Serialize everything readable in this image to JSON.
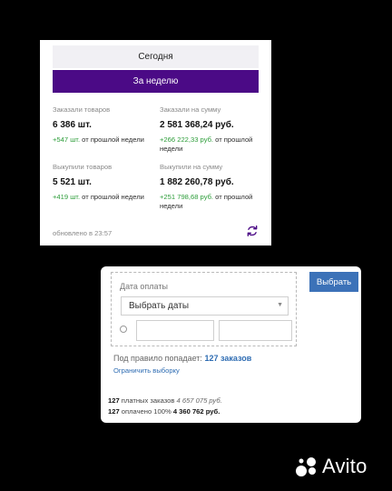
{
  "period": {
    "today": "Сегодня",
    "week": "За неделю"
  },
  "stats": [
    {
      "label": "Заказали товаров",
      "value": "6 386 шт.",
      "delta": "+547 шт.",
      "suffix": " от прошлой недели"
    },
    {
      "label": "Заказали на сумму",
      "value": "2 581 368,24 руб.",
      "delta": "+266 222,33 руб.",
      "suffix": " от прошлой недели"
    },
    {
      "label": "Выкупили товаров",
      "value": "5 521 шт.",
      "delta": "+419 шт.",
      "suffix": " от прошлой недели"
    },
    {
      "label": "Выкупили на сумму",
      "value": "1 882 260,78 руб.",
      "delta": "+251 798,68 руб.",
      "suffix": " от прошлой недели"
    }
  ],
  "updated": "обновлено в 23:57",
  "colors": {
    "accent": "#4b0a86",
    "positive": "#2d9d3a",
    "button": "#3c72b8",
    "link": "#2f6db3"
  },
  "icons": {
    "refresh": "refresh-icon",
    "clock": "clock-icon",
    "dropdown": "chevron-down-icon"
  },
  "filter": {
    "label": "Дата оплаты",
    "select_value": "Выбрать даты",
    "choose_button": "Выбрать",
    "rule_prefix": "Под правило попадает:",
    "rule_count": "127 заказов",
    "limit_link": "Ограничить выборку"
  },
  "totals": [
    {
      "count": "127",
      "text": " платных заказов ",
      "amount": "4 657 075 руб."
    },
    {
      "count": "127",
      "text": " оплачено 100% ",
      "amount": "4 360 762 руб."
    }
  ],
  "watermark": "Avito"
}
